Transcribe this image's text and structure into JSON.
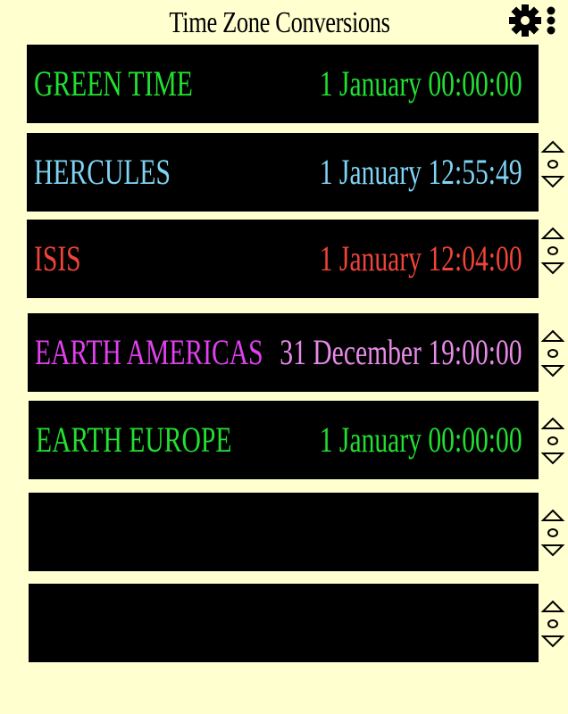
{
  "header": {
    "title": "Time Zone Conversions",
    "menu_icon": "gear-icon",
    "more_icon": "vertical-dots-icon"
  },
  "zones": [
    {
      "name": "GREEN TIME",
      "time": "1 January 00:00:00",
      "name_color": "#22e030",
      "time_color": "#22e030"
    },
    {
      "name": "HERCULES",
      "time": "1 January 12:55:49",
      "name_color": "#7ed4f4",
      "time_color": "#7ed4f4"
    },
    {
      "name": "ISIS",
      "time": "1 January 12:04:00",
      "name_color": "#f04438",
      "time_color": "#f04438"
    },
    {
      "name": "EARTH AMERICAS",
      "time": "31 December 19:00:00",
      "name_color": "#e040ee",
      "time_color": "#e88ae8"
    },
    {
      "name": "EARTH EUROPE",
      "time": "1 January 00:00:00",
      "name_color": "#22e030",
      "time_color": "#22e030"
    },
    {
      "name": "",
      "time": "",
      "name_color": "#ffffff",
      "time_color": "#ffffff"
    },
    {
      "name": "",
      "time": "",
      "name_color": "#ffffff",
      "time_color": "#ffffff"
    }
  ],
  "colors": {
    "background": "#ffffd0",
    "row_background": "#000000"
  },
  "order_controls": {
    "up_icon": "triangle-up-icon",
    "mid_icon": "circle-icon",
    "down_icon": "triangle-down-icon"
  }
}
